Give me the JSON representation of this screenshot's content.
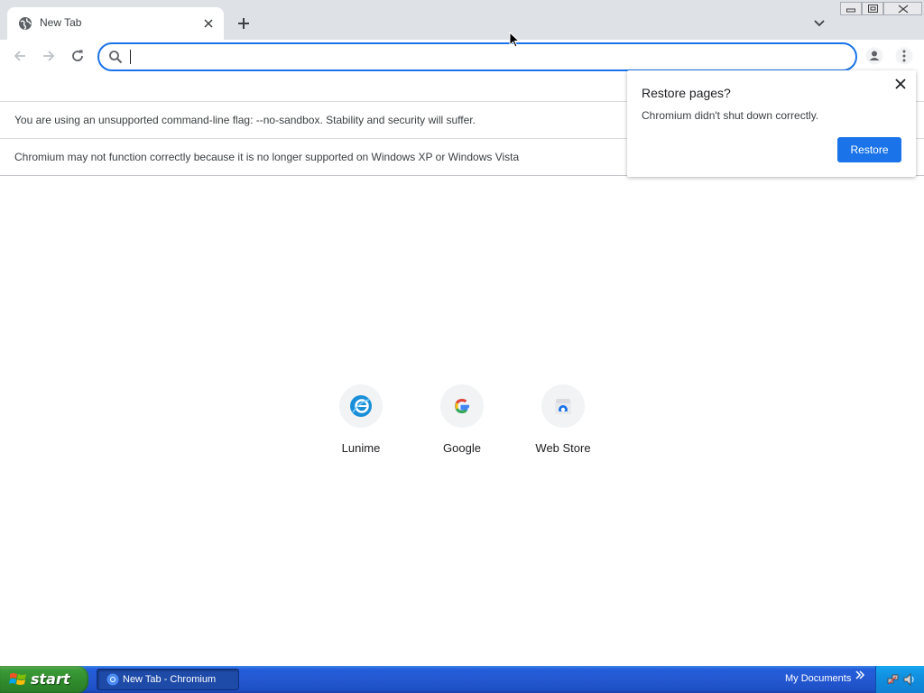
{
  "tabs": [
    {
      "title": "New Tab"
    }
  ],
  "omnibox": {
    "value": "",
    "placeholder": ""
  },
  "infobars": [
    {
      "text": "You are using an unsupported command-line flag: --no-sandbox. Stability and security will suffer."
    },
    {
      "text": "Chromium may not function correctly because it is no longer supported on Windows XP or Windows Vista"
    }
  ],
  "restore_bubble": {
    "title": "Restore pages?",
    "body": "Chromium didn't shut down correctly.",
    "button_label": "Restore"
  },
  "shortcuts": [
    {
      "label": "Lunime",
      "icon": "lunime-icon"
    },
    {
      "label": "Google",
      "icon": "google-icon"
    },
    {
      "label": "Web Store",
      "icon": "web-store-icon"
    }
  ],
  "taskbar": {
    "start_label": "start",
    "task_label": "New Tab - Chromium",
    "tray_folder": "My Documents"
  },
  "colors": {
    "accent": "#1a73e8",
    "tabstrip": "#dee1e6",
    "taskbar": "#245edb",
    "start_button": "#3c9a37"
  }
}
